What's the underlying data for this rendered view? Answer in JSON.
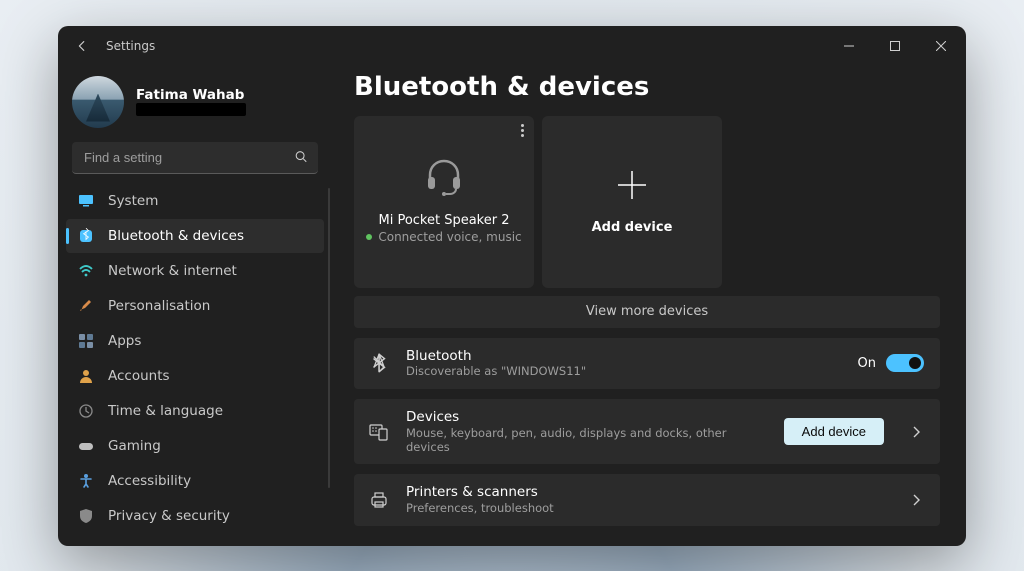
{
  "window": {
    "title": "Settings"
  },
  "profile": {
    "name": "Fatima Wahab",
    "email_redacted": true
  },
  "search": {
    "placeholder": "Find a setting"
  },
  "nav": {
    "items": [
      {
        "icon": "monitor",
        "label": "System",
        "selected": false
      },
      {
        "icon": "bluetooth",
        "label": "Bluetooth & devices",
        "selected": true
      },
      {
        "icon": "wifi",
        "label": "Network & internet",
        "selected": false
      },
      {
        "icon": "brush",
        "label": "Personalisation",
        "selected": false
      },
      {
        "icon": "apps",
        "label": "Apps",
        "selected": false
      },
      {
        "icon": "person",
        "label": "Accounts",
        "selected": false
      },
      {
        "icon": "globe-clock",
        "label": "Time & language",
        "selected": false
      },
      {
        "icon": "gamepad",
        "label": "Gaming",
        "selected": false
      },
      {
        "icon": "accessibility",
        "label": "Accessibility",
        "selected": false
      },
      {
        "icon": "shield",
        "label": "Privacy & security",
        "selected": false
      }
    ]
  },
  "page": {
    "title": "Bluetooth & devices"
  },
  "device_card": {
    "name": "Mi Pocket Speaker 2",
    "status": "Connected voice, music"
  },
  "add_card": {
    "label": "Add device"
  },
  "view_more": {
    "label": "View more devices"
  },
  "bluetooth_row": {
    "title": "Bluetooth",
    "subtitle": "Discoverable as \"WINDOWS11\"",
    "toggle_label": "On",
    "toggle_on": true
  },
  "devices_row": {
    "title": "Devices",
    "subtitle": "Mouse, keyboard, pen, audio, displays and docks, other devices",
    "button": "Add device"
  },
  "printers_row": {
    "title": "Printers & scanners",
    "subtitle": "Preferences, troubleshoot"
  }
}
